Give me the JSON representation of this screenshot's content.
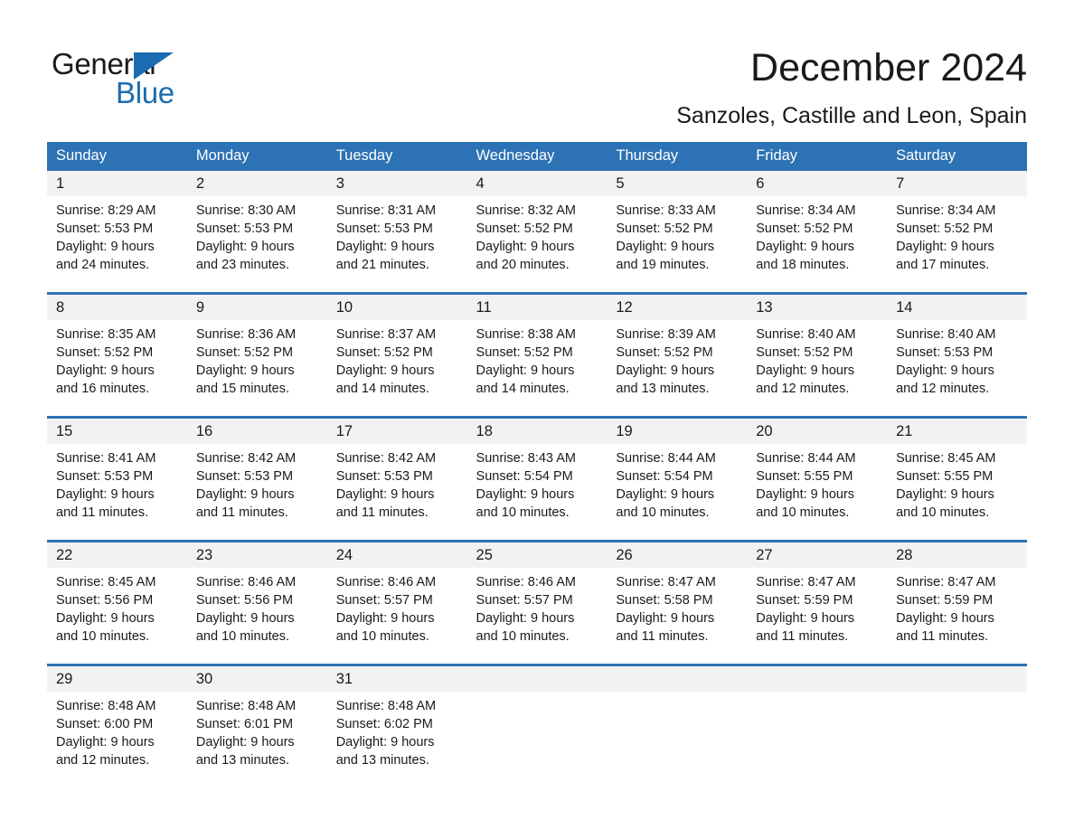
{
  "brand": {
    "logo_line1": "General",
    "logo_line2": "Blue",
    "triangle_icon": "triangle-icon",
    "accent_color": "#1b6cb0"
  },
  "header": {
    "title": "December 2024",
    "subtitle": "Sanzoles, Castille and Leon, Spain"
  },
  "calendar": {
    "header_bg": "#2d72b4",
    "daynum_bg": "#f2f2f2",
    "weekdays": [
      "Sunday",
      "Monday",
      "Tuesday",
      "Wednesday",
      "Thursday",
      "Friday",
      "Saturday"
    ],
    "weeks": [
      [
        {
          "day": "1",
          "sunrise": "Sunrise: 8:29 AM",
          "sunset": "Sunset: 5:53 PM",
          "daylight1": "Daylight: 9 hours",
          "daylight2": "and 24 minutes."
        },
        {
          "day": "2",
          "sunrise": "Sunrise: 8:30 AM",
          "sunset": "Sunset: 5:53 PM",
          "daylight1": "Daylight: 9 hours",
          "daylight2": "and 23 minutes."
        },
        {
          "day": "3",
          "sunrise": "Sunrise: 8:31 AM",
          "sunset": "Sunset: 5:53 PM",
          "daylight1": "Daylight: 9 hours",
          "daylight2": "and 21 minutes."
        },
        {
          "day": "4",
          "sunrise": "Sunrise: 8:32 AM",
          "sunset": "Sunset: 5:52 PM",
          "daylight1": "Daylight: 9 hours",
          "daylight2": "and 20 minutes."
        },
        {
          "day": "5",
          "sunrise": "Sunrise: 8:33 AM",
          "sunset": "Sunset: 5:52 PM",
          "daylight1": "Daylight: 9 hours",
          "daylight2": "and 19 minutes."
        },
        {
          "day": "6",
          "sunrise": "Sunrise: 8:34 AM",
          "sunset": "Sunset: 5:52 PM",
          "daylight1": "Daylight: 9 hours",
          "daylight2": "and 18 minutes."
        },
        {
          "day": "7",
          "sunrise": "Sunrise: 8:34 AM",
          "sunset": "Sunset: 5:52 PM",
          "daylight1": "Daylight: 9 hours",
          "daylight2": "and 17 minutes."
        }
      ],
      [
        {
          "day": "8",
          "sunrise": "Sunrise: 8:35 AM",
          "sunset": "Sunset: 5:52 PM",
          "daylight1": "Daylight: 9 hours",
          "daylight2": "and 16 minutes."
        },
        {
          "day": "9",
          "sunrise": "Sunrise: 8:36 AM",
          "sunset": "Sunset: 5:52 PM",
          "daylight1": "Daylight: 9 hours",
          "daylight2": "and 15 minutes."
        },
        {
          "day": "10",
          "sunrise": "Sunrise: 8:37 AM",
          "sunset": "Sunset: 5:52 PM",
          "daylight1": "Daylight: 9 hours",
          "daylight2": "and 14 minutes."
        },
        {
          "day": "11",
          "sunrise": "Sunrise: 8:38 AM",
          "sunset": "Sunset: 5:52 PM",
          "daylight1": "Daylight: 9 hours",
          "daylight2": "and 14 minutes."
        },
        {
          "day": "12",
          "sunrise": "Sunrise: 8:39 AM",
          "sunset": "Sunset: 5:52 PM",
          "daylight1": "Daylight: 9 hours",
          "daylight2": "and 13 minutes."
        },
        {
          "day": "13",
          "sunrise": "Sunrise: 8:40 AM",
          "sunset": "Sunset: 5:52 PM",
          "daylight1": "Daylight: 9 hours",
          "daylight2": "and 12 minutes."
        },
        {
          "day": "14",
          "sunrise": "Sunrise: 8:40 AM",
          "sunset": "Sunset: 5:53 PM",
          "daylight1": "Daylight: 9 hours",
          "daylight2": "and 12 minutes."
        }
      ],
      [
        {
          "day": "15",
          "sunrise": "Sunrise: 8:41 AM",
          "sunset": "Sunset: 5:53 PM",
          "daylight1": "Daylight: 9 hours",
          "daylight2": "and 11 minutes."
        },
        {
          "day": "16",
          "sunrise": "Sunrise: 8:42 AM",
          "sunset": "Sunset: 5:53 PM",
          "daylight1": "Daylight: 9 hours",
          "daylight2": "and 11 minutes."
        },
        {
          "day": "17",
          "sunrise": "Sunrise: 8:42 AM",
          "sunset": "Sunset: 5:53 PM",
          "daylight1": "Daylight: 9 hours",
          "daylight2": "and 11 minutes."
        },
        {
          "day": "18",
          "sunrise": "Sunrise: 8:43 AM",
          "sunset": "Sunset: 5:54 PM",
          "daylight1": "Daylight: 9 hours",
          "daylight2": "and 10 minutes."
        },
        {
          "day": "19",
          "sunrise": "Sunrise: 8:44 AM",
          "sunset": "Sunset: 5:54 PM",
          "daylight1": "Daylight: 9 hours",
          "daylight2": "and 10 minutes."
        },
        {
          "day": "20",
          "sunrise": "Sunrise: 8:44 AM",
          "sunset": "Sunset: 5:55 PM",
          "daylight1": "Daylight: 9 hours",
          "daylight2": "and 10 minutes."
        },
        {
          "day": "21",
          "sunrise": "Sunrise: 8:45 AM",
          "sunset": "Sunset: 5:55 PM",
          "daylight1": "Daylight: 9 hours",
          "daylight2": "and 10 minutes."
        }
      ],
      [
        {
          "day": "22",
          "sunrise": "Sunrise: 8:45 AM",
          "sunset": "Sunset: 5:56 PM",
          "daylight1": "Daylight: 9 hours",
          "daylight2": "and 10 minutes."
        },
        {
          "day": "23",
          "sunrise": "Sunrise: 8:46 AM",
          "sunset": "Sunset: 5:56 PM",
          "daylight1": "Daylight: 9 hours",
          "daylight2": "and 10 minutes."
        },
        {
          "day": "24",
          "sunrise": "Sunrise: 8:46 AM",
          "sunset": "Sunset: 5:57 PM",
          "daylight1": "Daylight: 9 hours",
          "daylight2": "and 10 minutes."
        },
        {
          "day": "25",
          "sunrise": "Sunrise: 8:46 AM",
          "sunset": "Sunset: 5:57 PM",
          "daylight1": "Daylight: 9 hours",
          "daylight2": "and 10 minutes."
        },
        {
          "day": "26",
          "sunrise": "Sunrise: 8:47 AM",
          "sunset": "Sunset: 5:58 PM",
          "daylight1": "Daylight: 9 hours",
          "daylight2": "and 11 minutes."
        },
        {
          "day": "27",
          "sunrise": "Sunrise: 8:47 AM",
          "sunset": "Sunset: 5:59 PM",
          "daylight1": "Daylight: 9 hours",
          "daylight2": "and 11 minutes."
        },
        {
          "day": "28",
          "sunrise": "Sunrise: 8:47 AM",
          "sunset": "Sunset: 5:59 PM",
          "daylight1": "Daylight: 9 hours",
          "daylight2": "and 11 minutes."
        }
      ],
      [
        {
          "day": "29",
          "sunrise": "Sunrise: 8:48 AM",
          "sunset": "Sunset: 6:00 PM",
          "daylight1": "Daylight: 9 hours",
          "daylight2": "and 12 minutes."
        },
        {
          "day": "30",
          "sunrise": "Sunrise: 8:48 AM",
          "sunset": "Sunset: 6:01 PM",
          "daylight1": "Daylight: 9 hours",
          "daylight2": "and 13 minutes."
        },
        {
          "day": "31",
          "sunrise": "Sunrise: 8:48 AM",
          "sunset": "Sunset: 6:02 PM",
          "daylight1": "Daylight: 9 hours",
          "daylight2": "and 13 minutes."
        },
        {
          "day": "",
          "sunrise": "",
          "sunset": "",
          "daylight1": "",
          "daylight2": ""
        },
        {
          "day": "",
          "sunrise": "",
          "sunset": "",
          "daylight1": "",
          "daylight2": ""
        },
        {
          "day": "",
          "sunrise": "",
          "sunset": "",
          "daylight1": "",
          "daylight2": ""
        },
        {
          "day": "",
          "sunrise": "",
          "sunset": "",
          "daylight1": "",
          "daylight2": ""
        }
      ]
    ]
  }
}
